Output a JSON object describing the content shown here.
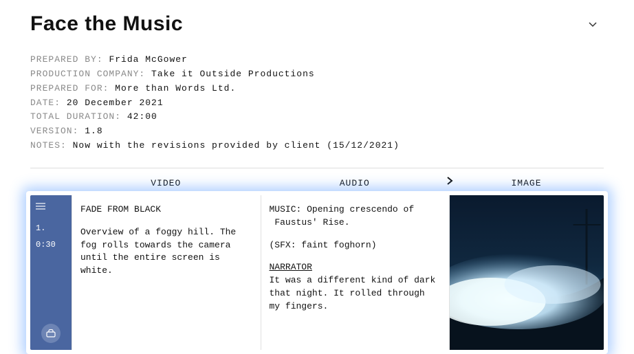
{
  "title": "Face the Music",
  "meta": {
    "prepared_by_label": "PREPARED BY:",
    "prepared_by": "Frida McGower",
    "production_company_label": "PRODUCTION COMPANY:",
    "production_company": "Take it Outside Productions",
    "prepared_for_label": "PREPARED FOR:",
    "prepared_for": "More than Words Ltd.",
    "date_label": "DATE:",
    "date": "20 December 2021",
    "total_duration_label": "TOTAL DURATION:",
    "total_duration": "42:00",
    "version_label": "VERSION:",
    "version": "1.8",
    "notes_label": "NOTES:",
    "notes": "Now with the revisions provided by client (15/12/2021)"
  },
  "columns": {
    "video": "VIDEO",
    "audio": "AUDIO",
    "image": "IMAGE"
  },
  "row": {
    "number": "1.",
    "time": "0:30",
    "video_line1": "FADE FROM BLACK",
    "video_line2": "Overview of a foggy hill. The fog rolls towards the camera until the entire screen is white.",
    "audio_line1": "MUSIC: Opening crescendo of\n Faustus' Rise.",
    "audio_line2": "(SFX: faint foghorn)",
    "audio_narrator_label": "NARRATOR",
    "audio_line3": "It was a different kind of dark that night. It rolled through my fingers."
  }
}
